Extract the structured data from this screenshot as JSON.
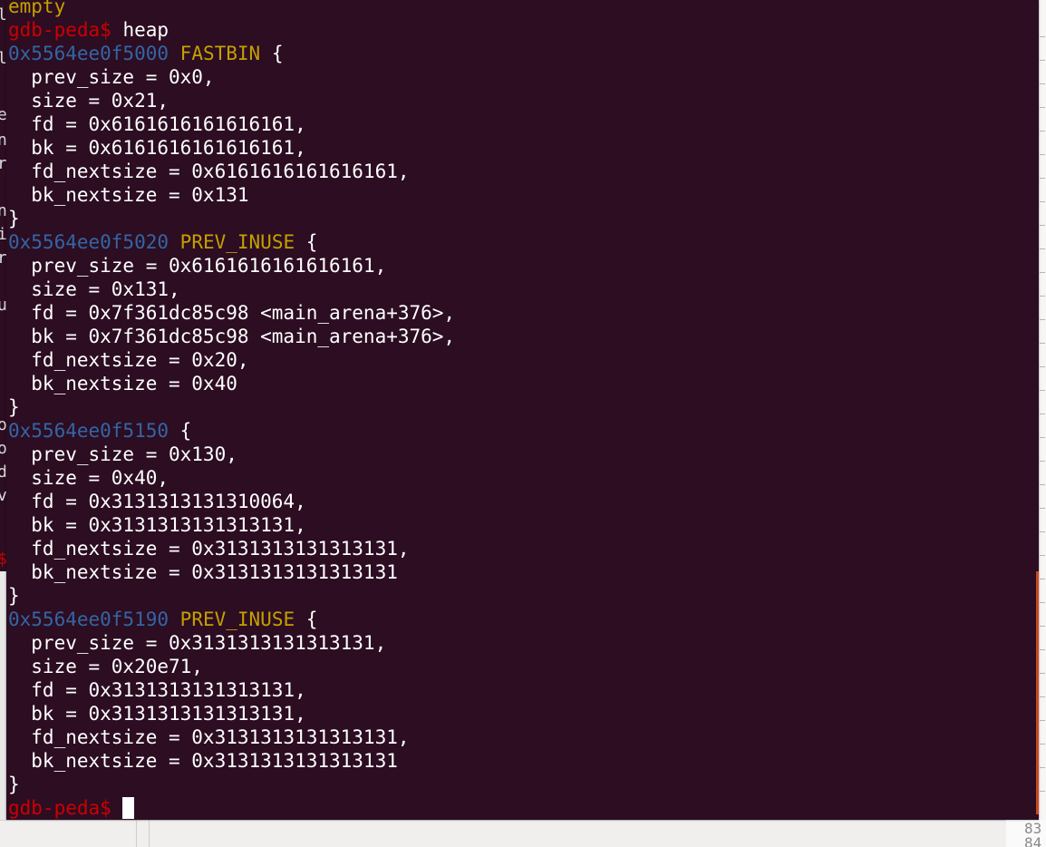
{
  "terminal": {
    "colors": {
      "background": "#2c0d22",
      "prompt": "#cc0000",
      "address": "#3465a4",
      "flag": "#c4a000",
      "text": "#ffffff"
    },
    "lines": [
      {
        "segments": [
          {
            "text": "empty",
            "color": "yellow"
          }
        ]
      },
      {
        "segments": [
          {
            "text": "gdb-peda$",
            "color": "red"
          },
          {
            "text": " heap",
            "color": "white"
          }
        ]
      },
      {
        "segments": [
          {
            "text": "0x5564ee0f5000",
            "color": "blue"
          },
          {
            "text": " ",
            "color": "white"
          },
          {
            "text": "FASTBIN",
            "color": "yellow"
          },
          {
            "text": " {",
            "color": "white"
          }
        ]
      },
      {
        "segments": [
          {
            "text": "  prev_size = 0x0,",
            "color": "white"
          }
        ]
      },
      {
        "segments": [
          {
            "text": "  size = 0x21,",
            "color": "white"
          }
        ]
      },
      {
        "segments": [
          {
            "text": "  fd = 0x6161616161616161,",
            "color": "white"
          }
        ]
      },
      {
        "segments": [
          {
            "text": "  bk = 0x6161616161616161,",
            "color": "white"
          }
        ]
      },
      {
        "segments": [
          {
            "text": "  fd_nextsize = 0x6161616161616161,",
            "color": "white"
          }
        ]
      },
      {
        "segments": [
          {
            "text": "  bk_nextsize = 0x131",
            "color": "white"
          }
        ]
      },
      {
        "segments": [
          {
            "text": "}",
            "color": "white"
          }
        ]
      },
      {
        "segments": [
          {
            "text": "0x5564ee0f5020",
            "color": "blue"
          },
          {
            "text": " ",
            "color": "white"
          },
          {
            "text": "PREV_INUSE",
            "color": "yellow"
          },
          {
            "text": " {",
            "color": "white"
          }
        ]
      },
      {
        "segments": [
          {
            "text": "  prev_size = 0x6161616161616161,",
            "color": "white"
          }
        ]
      },
      {
        "segments": [
          {
            "text": "  size = 0x131,",
            "color": "white"
          }
        ]
      },
      {
        "segments": [
          {
            "text": "  fd = 0x7f361dc85c98 <main_arena+376>,",
            "color": "white"
          }
        ]
      },
      {
        "segments": [
          {
            "text": "  bk = 0x7f361dc85c98 <main_arena+376>,",
            "color": "white"
          }
        ]
      },
      {
        "segments": [
          {
            "text": "  fd_nextsize = 0x20,",
            "color": "white"
          }
        ]
      },
      {
        "segments": [
          {
            "text": "  bk_nextsize = 0x40",
            "color": "white"
          }
        ]
      },
      {
        "segments": [
          {
            "text": "}",
            "color": "white"
          }
        ]
      },
      {
        "segments": [
          {
            "text": "0x5564ee0f5150",
            "color": "blue"
          },
          {
            "text": " {",
            "color": "white"
          }
        ]
      },
      {
        "segments": [
          {
            "text": "  prev_size = 0x130,",
            "color": "white"
          }
        ]
      },
      {
        "segments": [
          {
            "text": "  size = 0x40,",
            "color": "white"
          }
        ]
      },
      {
        "segments": [
          {
            "text": "  fd = 0x3131313131310064,",
            "color": "white"
          }
        ]
      },
      {
        "segments": [
          {
            "text": "  bk = 0x3131313131313131,",
            "color": "white"
          }
        ]
      },
      {
        "segments": [
          {
            "text": "  fd_nextsize = 0x3131313131313131,",
            "color": "white"
          }
        ]
      },
      {
        "segments": [
          {
            "text": "  bk_nextsize = 0x3131313131313131",
            "color": "white"
          }
        ]
      },
      {
        "segments": [
          {
            "text": "}",
            "color": "white"
          }
        ]
      },
      {
        "segments": [
          {
            "text": "0x5564ee0f5190",
            "color": "blue"
          },
          {
            "text": " ",
            "color": "white"
          },
          {
            "text": "PREV_INUSE",
            "color": "yellow"
          },
          {
            "text": " {",
            "color": "white"
          }
        ]
      },
      {
        "segments": [
          {
            "text": "  prev_size = 0x3131313131313131,",
            "color": "white"
          }
        ]
      },
      {
        "segments": [
          {
            "text": "  size = 0x20e71,",
            "color": "white"
          }
        ]
      },
      {
        "segments": [
          {
            "text": "  fd = 0x3131313131313131,",
            "color": "white"
          }
        ]
      },
      {
        "segments": [
          {
            "text": "  bk = 0x3131313131313131,",
            "color": "white"
          }
        ]
      },
      {
        "segments": [
          {
            "text": "  fd_nextsize = 0x3131313131313131,",
            "color": "white"
          }
        ]
      },
      {
        "segments": [
          {
            "text": "  bk_nextsize = 0x3131313131313131",
            "color": "white"
          }
        ]
      },
      {
        "segments": [
          {
            "text": "}",
            "color": "white"
          }
        ]
      }
    ],
    "prompt_line": {
      "prompt": "gdb-peda$",
      "input": " "
    }
  },
  "background_editor": {
    "gutter_numbers": [
      "83",
      "84"
    ]
  }
}
